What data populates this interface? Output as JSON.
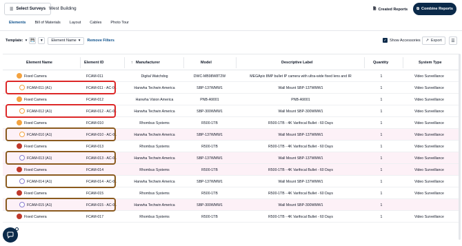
{
  "topbar": {
    "select_surveys": "Select Surveys",
    "building": "West Building",
    "created_reports": "Created Reports",
    "combine_reports": "Combine Reports"
  },
  "tabs": [
    {
      "label": "Elements",
      "active": true
    },
    {
      "label": "Bill of Materials",
      "active": false
    },
    {
      "label": "Layout",
      "active": false
    },
    {
      "label": "Cables",
      "active": false
    },
    {
      "label": "Photo Tour",
      "active": false
    }
  ],
  "toolbar": {
    "template_label": "Template:",
    "element_name_select": "Element Name",
    "remove_filters": "Remove Filters",
    "show_accessories": "Show Accessories",
    "export": "Export"
  },
  "columns": [
    "Element Name",
    "Element ID",
    "Manufacturer",
    "Model",
    "Descriptive Label",
    "Quantity",
    "System Type"
  ],
  "rows": [
    {
      "name": "Fixed Camera",
      "id": "FCAM-011",
      "manufacturer": "Digital Watchdog",
      "model": "DWC-MB98W8T2W",
      "label": "MEGApix 8MP bullet IP camera with ultra-wide fixed lens and IR",
      "qty": "1",
      "system": "Video Surveillance",
      "icon": "filled-orange",
      "kind": "parent"
    },
    {
      "name": "FCAM-011 (A1)",
      "id": "FCAM-011 - AC-01",
      "manufacturer": "Hanwha Techwin America",
      "model": "SBP-137WMW1",
      "label": "Wall Mount SBP-137WMW1",
      "qty": "1",
      "system": "Video Surveillance",
      "icon": "outline-orange",
      "kind": "child"
    },
    {
      "name": "Fixed Camera",
      "id": "FCAM-012",
      "manufacturer": "Hanwha Vision America",
      "model": "PNB-A9001",
      "label": "PNB-A9001",
      "qty": "1",
      "system": "Video Surveillance",
      "icon": "filled-orange",
      "kind": "parent"
    },
    {
      "name": "FCAM-012 (A1)",
      "id": "FCAM-012 - AC-01",
      "manufacturer": "Hanwha Techwin America",
      "model": "SBP-300WMW1",
      "label": "Wall Mount SBP-300WMW1",
      "qty": "1",
      "system": "Video Surveillance",
      "icon": "outline-orange",
      "kind": "child"
    },
    {
      "name": "Fixed Camera",
      "id": "FCAM-010",
      "manufacturer": "Rhombus Systems",
      "model": "R500-1TB",
      "label": "R500-1TB - 4K Varifocal Bullet - 60 Days",
      "qty": "1",
      "system": "Video Surveillance",
      "icon": "filled-orange",
      "kind": "parent"
    },
    {
      "name": "FCAM-010 (A1)",
      "id": "FCAM-010 - AC-01",
      "manufacturer": "Hanwha Techwin America",
      "model": "SBP-137WMW1",
      "label": "Wall Mount SBP-137WMW1",
      "qty": "1",
      "system": "Video Surveillance",
      "icon": "outline-orange",
      "kind": "highlight"
    },
    {
      "name": "Fixed Camera",
      "id": "FCAM-013",
      "manufacturer": "Rhombus Systems",
      "model": "R500-1TB",
      "label": "R500-1TB - 4K Varifocal Bullet - 60 Days",
      "qty": "1",
      "system": "Video Surveillance",
      "icon": "filled-red",
      "kind": "parent"
    },
    {
      "name": "FCAM-013 (A1)",
      "id": "FCAM-013 - AC-01",
      "manufacturer": "Hanwha Techwin America",
      "model": "SBP-137WMW1",
      "label": "Wall Mount SBP-137WMW1",
      "qty": "1",
      "system": "Video Surveillance",
      "icon": "outline-purple",
      "kind": "highlight"
    },
    {
      "name": "Fixed Camera",
      "id": "FCAM-014",
      "manufacturer": "Rhombus Systems",
      "model": "R500-1TB",
      "label": "R500-1TB - 4K Varifocal Bullet - 60 Days",
      "qty": "1",
      "system": "Video Surveillance",
      "icon": "filled-red",
      "kind": "highlight"
    },
    {
      "name": "FCAM-014 (A1)",
      "id": "FCAM-014 - AC-01",
      "manufacturer": "Hanwha Techwin America",
      "model": "SBP-137WMW1",
      "label": "Wall Mount SBP-137WMW1",
      "qty": "1",
      "system": "Video Surveillance",
      "icon": "outline-purple",
      "kind": "child"
    },
    {
      "name": "Fixed Camera",
      "id": "FCAM-015",
      "manufacturer": "Rhombus Systems",
      "model": "R500-1TB",
      "label": "R500-1TB - 4K Varifocal Bullet - 60 Days",
      "qty": "1",
      "system": "Video Surveillance",
      "icon": "filled-red",
      "kind": "parent"
    },
    {
      "name": "FCAM-015 (A1)",
      "id": "FCAM-015 - AC-01",
      "manufacturer": "Hanwha Techwin America",
      "model": "SBP-300WMW1",
      "label": "Wall Mount SBP-300WMW1",
      "qty": "1",
      "system": "",
      "icon": "outline-purple",
      "kind": "highlight"
    },
    {
      "name": "Fixed Camera",
      "id": "FCAM-017",
      "manufacturer": "Rhombus Systems",
      "model": "R500-1TB",
      "label": "R500-1TB - 4K Varifocal Bullet - 60 Days",
      "qty": "1",
      "system": "Video Surveillance",
      "icon": "filled-red",
      "kind": "parent"
    }
  ],
  "annotation_colors": {
    "red": "#dc2626",
    "brown": "#8a5a1e"
  },
  "annotations": [
    {
      "row": 1,
      "color": "red"
    },
    {
      "row": 3,
      "color": "red"
    },
    {
      "row": 5,
      "color": "brown"
    },
    {
      "row": 7,
      "color": "brown"
    },
    {
      "row": 9,
      "color": "brown"
    },
    {
      "row": 11,
      "color": "brown"
    }
  ]
}
